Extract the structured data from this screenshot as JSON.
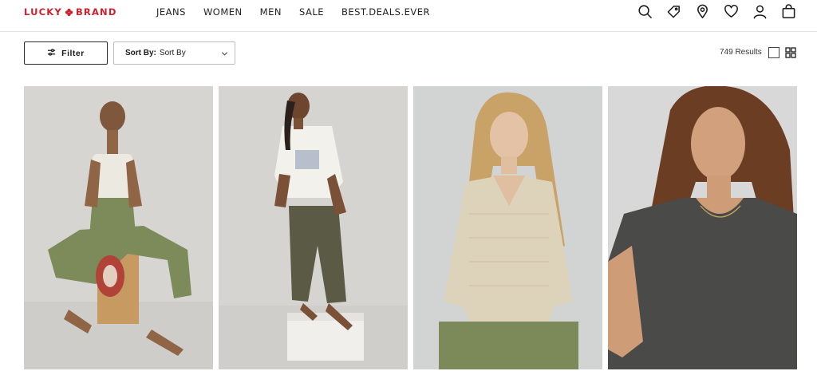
{
  "brand": {
    "logo_left": "LUCKY",
    "logo_right": "BRAND",
    "accent_color": "#d0202c"
  },
  "nav": {
    "items": [
      "JEANS",
      "WOMEN",
      "MEN",
      "SALE",
      "BEST.DEALS.EVER"
    ]
  },
  "header_icons": [
    "search-icon",
    "tag-icon",
    "location-icon",
    "heart-icon",
    "account-icon",
    "bag-icon"
  ],
  "toolbar": {
    "filter_label": "Filter",
    "sort_label": "Sort By:",
    "sort_value": "Sort By",
    "results_text": "749 Results"
  },
  "products": [
    {
      "image": "model in white tank top and olive cargo pants seated on wooden crate"
    },
    {
      "image": "model in white open shirt and olive cargo pants standing on white box"
    },
    {
      "image": "model in beige open-knit v-neck sweater"
    },
    {
      "image": "model in charcoal gray oversized tee"
    }
  ]
}
